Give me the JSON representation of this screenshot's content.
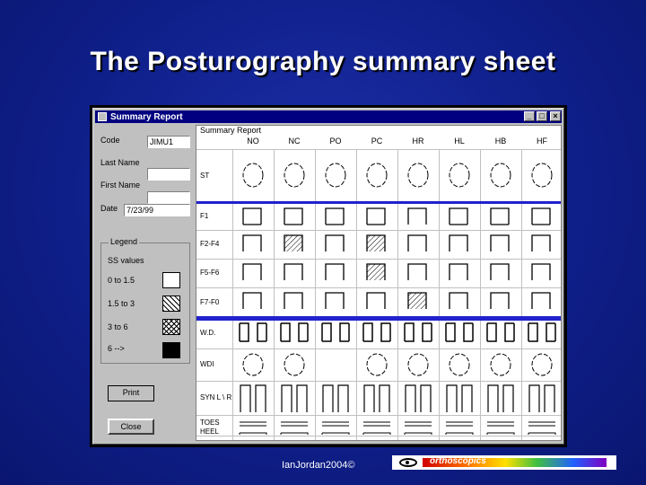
{
  "slide": {
    "title": "The Posturography summary sheet",
    "footer": "IanJordan2004©",
    "logo_text": "orthoscopics"
  },
  "window": {
    "title": "Summary Report",
    "buttons": {
      "minimize": "_",
      "maximize": "□",
      "close": "×"
    }
  },
  "form": {
    "code_label": "Code",
    "code_value": "JIMU1",
    "last_name_label": "Last Name",
    "last_name_value": "",
    "first_name_label": "First Name",
    "first_name_value": "",
    "date_label": "Date",
    "date_value": "7/23/99"
  },
  "legend": {
    "title": "Legend",
    "subtitle": "SS values",
    "items": [
      {
        "label": "0 to 1.5",
        "pattern": "empty"
      },
      {
        "label": "1.5 to 3",
        "pattern": "hatch"
      },
      {
        "label": "3 to 6",
        "pattern": "crosshatch"
      },
      {
        "label": "6 -->",
        "pattern": "solid"
      }
    ]
  },
  "actions": {
    "print": "Print",
    "close": "Close"
  },
  "grid": {
    "title": "Summary Report",
    "columns": [
      "NO",
      "NC",
      "PO",
      "PC",
      "HR",
      "HL",
      "HB",
      "HF"
    ],
    "rows": [
      "ST",
      "F1",
      "F2-F4",
      "F5-F6",
      "F7-F0",
      "W.D.",
      "WDI",
      "SYN L \\ R",
      "TOES",
      "HEEL"
    ],
    "hatched_cells": [
      [
        "F2-F4",
        "NC"
      ],
      [
        "F2-F4",
        "PC"
      ],
      [
        "F5-F6",
        "PC"
      ],
      [
        "F7-F0",
        "HR"
      ]
    ]
  },
  "colors": {
    "slide_bg": "#0f1f8a",
    "titlebar": "#000080",
    "separator": "#2222cc"
  }
}
